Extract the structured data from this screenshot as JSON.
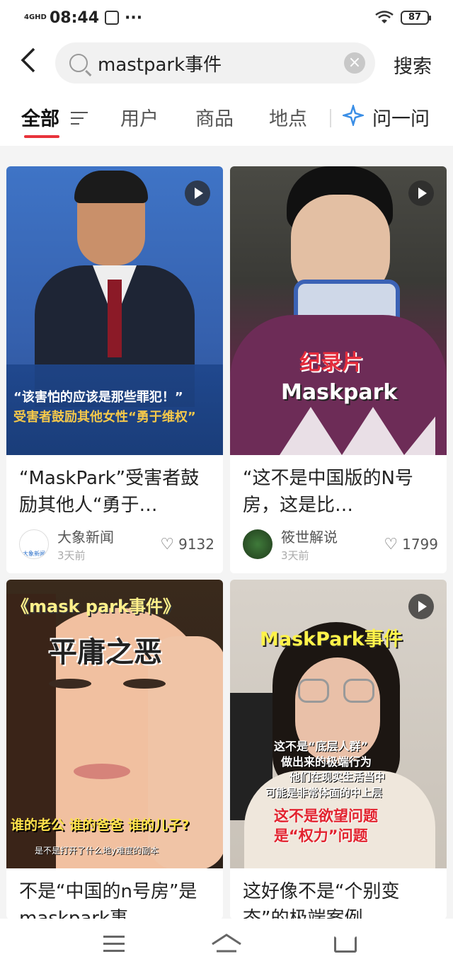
{
  "status": {
    "network": "4GHD",
    "time": "08:44",
    "battery": "87"
  },
  "search": {
    "query": "mastpark事件",
    "submit_label": "搜索"
  },
  "tabs": {
    "all": "全部",
    "users": "用户",
    "products": "商品",
    "places": "地点",
    "ask": "问一问"
  },
  "cards": [
    {
      "title": "“MaskPark”受害者鼓励其他人“勇于…",
      "overlay_line1": "“该害怕的应该是那些罪犯！”",
      "overlay_line2": "受害者鼓励其他女性“勇于维权”",
      "author": "大象新闻",
      "avatar_text": "大象新闻",
      "date": "3天前",
      "likes": "9132",
      "is_video": true
    },
    {
      "title": "“这不是中国版的N号房，这是比…",
      "overlay_line1": "纪录片",
      "overlay_line2": "Maskpark",
      "author": "筱世解说",
      "date": "3天前",
      "likes": "1799",
      "is_video": true
    },
    {
      "title": "不是“中国的n号房”是maskpark事",
      "overlay_line1": "《mask park事件》",
      "overlay_line2": "平庸之恶",
      "overlay_line3": "谁的老公 谁的爸爸 谁的儿子?",
      "overlay_line4": "是不是打开了什么地y难度的副本",
      "is_video": false
    },
    {
      "title": "这好像不是“个别变态”的极端案例",
      "overlay_line1": "MaskPark事件",
      "overlay_line2": "这不是“底层人群”",
      "overlay_line3": "做出来的极端行为",
      "overlay_line4": "他们在现实生活当中",
      "overlay_line5": "可能是非常体面的中上层",
      "overlay_line6": "这不是欲望问题",
      "overlay_line7": "是“权力”问题",
      "is_video": true
    }
  ],
  "colors": {
    "accent": "#e8333b",
    "ask_icon": "#3a8ee6"
  },
  "icons": {
    "back": "chevron-left-icon",
    "search": "search-icon",
    "clear": "clear-icon",
    "filter": "filter-icon",
    "ask": "ai-sparkle-icon",
    "heart": "heart-icon",
    "play": "play-icon"
  }
}
